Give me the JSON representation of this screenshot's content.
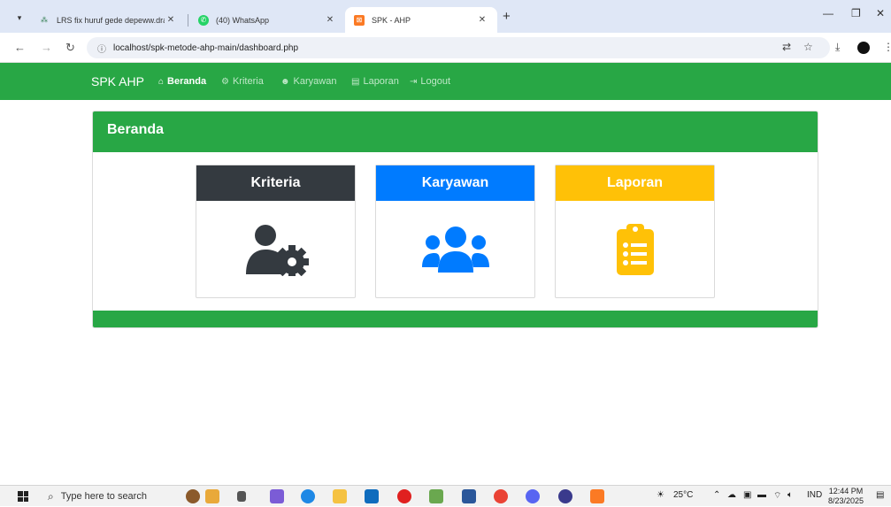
{
  "browser": {
    "tabs": [
      {
        "title": "LRS fix huruf gede depeww.drawio",
        "icon": "drawio-icon",
        "active": false
      },
      {
        "title": "(40) WhatsApp",
        "icon": "whatsapp-icon",
        "active": false
      },
      {
        "title": "SPK - AHP",
        "icon": "xampp-icon",
        "active": true
      }
    ],
    "address": "localhost/spk-metode-ahp-main/dashboard.php"
  },
  "navbar": {
    "brand": "SPK AHP",
    "links": [
      {
        "label": "Beranda",
        "icon": "home-icon",
        "active": true
      },
      {
        "label": "Kriteria",
        "icon": "users-cog-icon",
        "active": false
      },
      {
        "label": "Karyawan",
        "icon": "users-icon",
        "active": false
      },
      {
        "label": "Laporan",
        "icon": "clipboard-icon",
        "active": false
      },
      {
        "label": "Logout",
        "icon": "sign-out-icon",
        "active": false
      }
    ]
  },
  "main": {
    "header": "Beranda",
    "tiles": [
      {
        "title": "Kriteria",
        "color": "#343a40",
        "icon": "user-cog-icon"
      },
      {
        "title": "Karyawan",
        "color": "#007bff",
        "icon": "users-icon"
      },
      {
        "title": "Laporan",
        "color": "#ffc107",
        "icon": "clipboard-list-icon"
      }
    ]
  },
  "colors": {
    "success": "#28a745",
    "dark": "#343a40",
    "primary": "#007bff",
    "warning": "#ffc107"
  },
  "taskbar": {
    "search_placeholder": "Type here to search",
    "weather": "25°C",
    "language": "IND",
    "time": "12:44 PM",
    "date": "8/23/2025"
  }
}
